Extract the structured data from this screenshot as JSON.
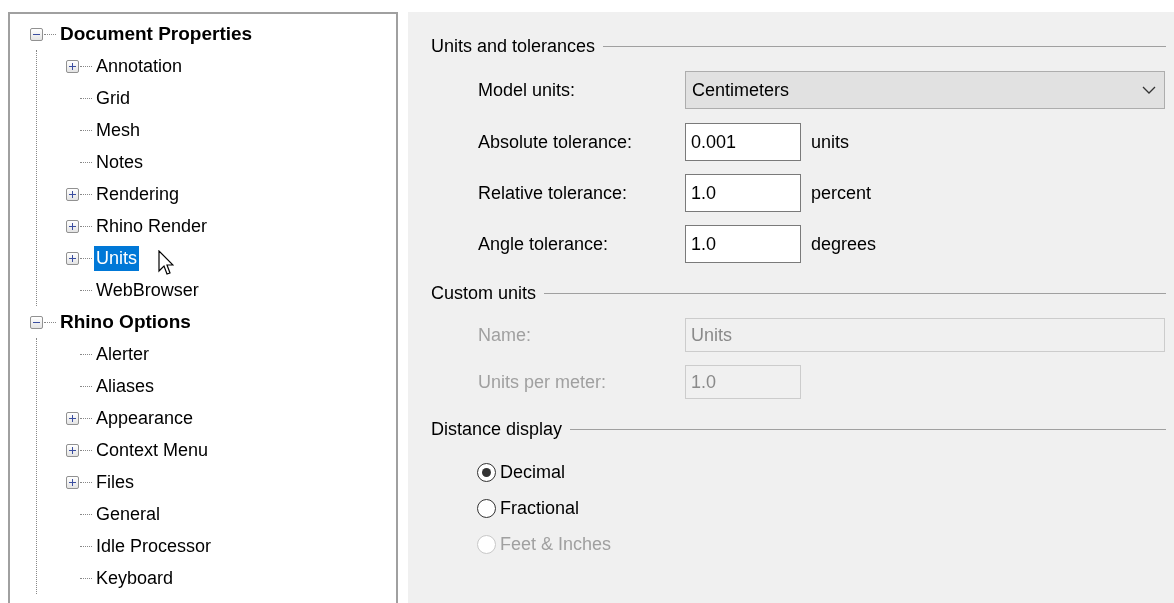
{
  "tree": [
    {
      "label": "Document Properties",
      "expanded": true,
      "selected": false,
      "children": [
        {
          "label": "Annotation",
          "expanded": false,
          "selected": false
        },
        {
          "label": "Grid",
          "selected": false
        },
        {
          "label": "Mesh",
          "selected": false
        },
        {
          "label": "Notes",
          "selected": false
        },
        {
          "label": "Rendering",
          "expanded": false,
          "selected": false
        },
        {
          "label": "Rhino Render",
          "expanded": false,
          "selected": false
        },
        {
          "label": "Units",
          "expanded": false,
          "selected": true
        },
        {
          "label": "WebBrowser",
          "selected": false
        }
      ]
    },
    {
      "label": "Rhino Options",
      "expanded": true,
      "selected": false,
      "children": [
        {
          "label": "Alerter",
          "selected": false
        },
        {
          "label": "Aliases",
          "selected": false
        },
        {
          "label": "Appearance",
          "expanded": false,
          "selected": false
        },
        {
          "label": "Context Menu",
          "expanded": false,
          "selected": false
        },
        {
          "label": "Files",
          "expanded": false,
          "selected": false
        },
        {
          "label": "General",
          "selected": false
        },
        {
          "label": "Idle Processor",
          "selected": false
        },
        {
          "label": "Keyboard",
          "selected": false
        }
      ]
    }
  ],
  "sections": [
    {
      "title": "Units and tolerances",
      "kind": "fields",
      "rows": [
        {
          "kind": "dropdown",
          "label": "Model units:",
          "value": "Centimeters",
          "disabled": false
        },
        {
          "kind": "input",
          "label": "Absolute tolerance:",
          "value": "0.001",
          "unit": "units",
          "disabled": false
        },
        {
          "kind": "input",
          "label": "Relative tolerance:",
          "value": "1.0",
          "unit": "percent",
          "disabled": false
        },
        {
          "kind": "input",
          "label": "Angle tolerance:",
          "value": "1.0",
          "unit": "degrees",
          "disabled": false
        }
      ]
    },
    {
      "title": "Custom units",
      "kind": "fields",
      "rows": [
        {
          "kind": "wide-input",
          "label": "Name:",
          "value": "Units",
          "disabled": true
        },
        {
          "kind": "input",
          "label": "Units per meter:",
          "value": "1.0",
          "disabled": true
        }
      ]
    },
    {
      "title": "Distance display",
      "kind": "radios",
      "options": [
        {
          "label": "Decimal",
          "selected": true,
          "disabled": false
        },
        {
          "label": "Fractional",
          "selected": false,
          "disabled": false
        },
        {
          "label": "Feet & Inches",
          "selected": false,
          "disabled": true
        }
      ]
    }
  ]
}
